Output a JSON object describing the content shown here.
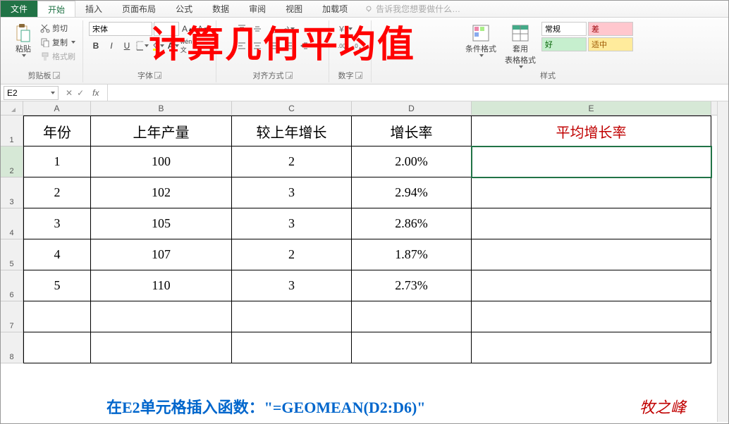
{
  "menu": {
    "file": "文件",
    "home": "开始",
    "insert": "插入",
    "layout": "页面布局",
    "formula": "公式",
    "data": "数据",
    "review": "审阅",
    "view": "视图",
    "addin": "加载项",
    "hint": "告诉我您想要做什么…"
  },
  "ribbon": {
    "clipboard": {
      "paste": "粘贴",
      "cut": "剪切",
      "copy": "复制",
      "painter": "格式刷",
      "label": "剪贴板"
    },
    "font": {
      "name": "宋体",
      "size": "",
      "b": "B",
      "i": "I",
      "u": "U",
      "label": "字体"
    },
    "align": {
      "label": "对齐方式"
    },
    "number": {
      "label": "数字"
    },
    "styles": {
      "cond": "条件格式",
      "table": "套用\n表格格式",
      "normal": "常规",
      "bad": "差",
      "good": "好",
      "neutral": "适中",
      "label": "样式"
    }
  },
  "overlay": "计算几何平均值",
  "namebox": "E2",
  "formula": "",
  "cols": {
    "A": "A",
    "B": "B",
    "C": "C",
    "D": "D",
    "E": "E"
  },
  "colw": {
    "A": 96,
    "B": 200,
    "C": 170,
    "D": 170,
    "E": 340
  },
  "headers": {
    "A": "年份",
    "B": "上年产量",
    "C": "较上年增长",
    "D": "增长率",
    "E": "平均增长率"
  },
  "rows": [
    {
      "n": "1",
      "A": "1",
      "B": "100",
      "C": "2",
      "D": "2.00%",
      "E": ""
    },
    {
      "n": "2",
      "A": "2",
      "B": "102",
      "C": "3",
      "D": "2.94%",
      "E": ""
    },
    {
      "n": "3",
      "A": "3",
      "B": "105",
      "C": "3",
      "D": "2.86%",
      "E": ""
    },
    {
      "n": "4",
      "A": "4",
      "B": "107",
      "C": "2",
      "D": "1.87%",
      "E": ""
    },
    {
      "n": "5",
      "A": "5",
      "B": "110",
      "C": "3",
      "D": "2.73%",
      "E": ""
    }
  ],
  "rownums": [
    "1",
    "2",
    "3",
    "4",
    "5",
    "6",
    "7",
    "8"
  ],
  "footer": "在E2单元格插入函数：\"=GEOMEAN(D2:D6)\"",
  "sig": "牧之峰"
}
